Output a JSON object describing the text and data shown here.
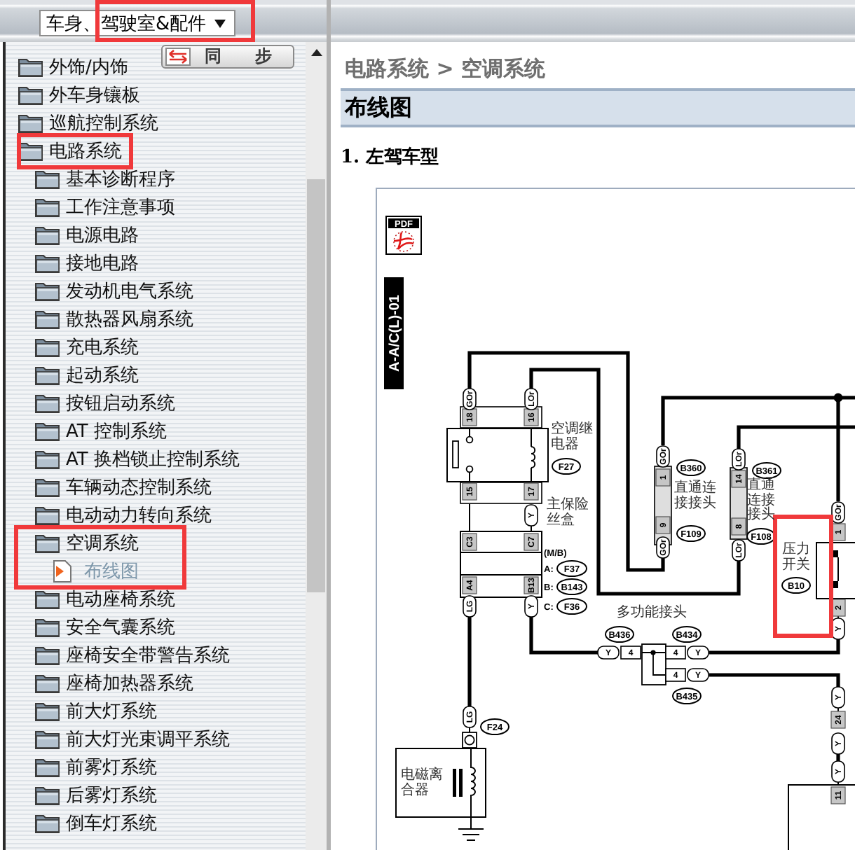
{
  "sidebar": {
    "category": {
      "value": "车身、驾驶室&配件",
      "marked": true
    },
    "sync_button": "同 步",
    "tree": [
      {
        "label": "外饰/内饰",
        "kind": "folder",
        "selected": false,
        "highlighted": false
      },
      {
        "label": "外车身镶板",
        "kind": "folder",
        "selected": false,
        "highlighted": false
      },
      {
        "label": "巡航控制系统",
        "kind": "folder",
        "selected": false,
        "highlighted": false
      },
      {
        "label": "电路系统",
        "kind": "folder",
        "selected": false,
        "highlighted": true,
        "children": [
          {
            "label": "基本诊断程序",
            "kind": "folder",
            "selected": false,
            "highlighted": false
          },
          {
            "label": "工作注意事项",
            "kind": "folder",
            "selected": false,
            "highlighted": false
          },
          {
            "label": "电源电路",
            "kind": "folder",
            "selected": false,
            "highlighted": false
          },
          {
            "label": "接地电路",
            "kind": "folder",
            "selected": false,
            "highlighted": false
          },
          {
            "label": "发动机电气系统",
            "kind": "folder",
            "selected": false,
            "highlighted": false
          },
          {
            "label": "散热器风扇系统",
            "kind": "folder",
            "selected": false,
            "highlighted": false
          },
          {
            "label": "充电系统",
            "kind": "folder",
            "selected": false,
            "highlighted": false
          },
          {
            "label": "起动系统",
            "kind": "folder",
            "selected": false,
            "highlighted": false
          },
          {
            "label": "按钮启动系统",
            "kind": "folder",
            "selected": false,
            "highlighted": false
          },
          {
            "label": "AT 控制系统",
            "kind": "folder",
            "selected": false,
            "highlighted": false
          },
          {
            "label": "AT 换档锁止控制系统",
            "kind": "folder",
            "selected": false,
            "highlighted": false
          },
          {
            "label": "车辆动态控制系统",
            "kind": "folder",
            "selected": false,
            "highlighted": false
          },
          {
            "label": "电动动力转向系统",
            "kind": "folder",
            "selected": false,
            "highlighted": false
          },
          {
            "label": "空调系统",
            "kind": "folder",
            "selected": false,
            "highlighted": true,
            "children": [
              {
                "label": "布线图",
                "kind": "document",
                "selected": true,
                "highlighted": true
              }
            ]
          },
          {
            "label": "电动座椅系统",
            "kind": "folder",
            "selected": false,
            "highlighted": false
          },
          {
            "label": "安全气囊系统",
            "kind": "folder",
            "selected": false,
            "highlighted": false
          },
          {
            "label": "座椅安全带警告系统",
            "kind": "folder",
            "selected": false,
            "highlighted": false
          },
          {
            "label": "座椅加热器系统",
            "kind": "folder",
            "selected": false,
            "highlighted": false
          },
          {
            "label": "前大灯系统",
            "kind": "folder",
            "selected": false,
            "highlighted": false
          },
          {
            "label": "前大灯光束调平系统",
            "kind": "folder",
            "selected": false,
            "highlighted": false
          },
          {
            "label": "前雾灯系统",
            "kind": "folder",
            "selected": false,
            "highlighted": false
          },
          {
            "label": "后雾灯系统",
            "kind": "folder",
            "selected": false,
            "highlighted": false
          },
          {
            "label": "倒车灯系统",
            "kind": "folder",
            "selected": false,
            "highlighted": false
          }
        ]
      }
    ]
  },
  "content": {
    "breadcrumb": "电路系统 > 空调系统",
    "section_title": "布线图",
    "subsection": "1. 左驾车型",
    "figure": {
      "pdf_label": "PDF",
      "code": "A-A/C(L)-01",
      "captions": [
        "空调继电器",
        "主保险丝盒",
        "直通连接接头",
        "直通连接接头",
        "压力开关",
        "多功能接头",
        "电磁离合器"
      ],
      "fuse_box_code": "(M/B)",
      "fuse_refs": [
        {
          "letter": "A:",
          "code": "F37"
        },
        {
          "letter": "B:",
          "code": "B143"
        },
        {
          "letter": "C:",
          "code": "F36"
        }
      ],
      "connectors": [
        {
          "code": "F27",
          "marked": false
        },
        {
          "code": "B360",
          "marked": false
        },
        {
          "code": "F109",
          "marked": false
        },
        {
          "code": "B361",
          "marked": false
        },
        {
          "code": "F108",
          "marked": false
        },
        {
          "code": "B10",
          "marked": true
        },
        {
          "code": "B436",
          "marked": false
        },
        {
          "code": "B434",
          "marked": false
        },
        {
          "code": "B435",
          "marked": false
        },
        {
          "code": "F24",
          "marked": false
        }
      ],
      "pins": [
        "18",
        "16",
        "15",
        "17",
        "C3",
        "C7",
        "A4",
        "B13",
        "1",
        "9",
        "14",
        "8",
        "1",
        "2",
        "24",
        "11",
        "4",
        "4",
        "4"
      ],
      "wire_colors": [
        "GOr",
        "LOr",
        "Y",
        "LG",
        "Y",
        "GOr",
        "GOr",
        "LOr",
        "LOr",
        "GOr",
        "Y",
        "LG",
        "Y",
        "Y",
        "Y",
        "Y",
        "Y",
        "Y"
      ]
    }
  }
}
